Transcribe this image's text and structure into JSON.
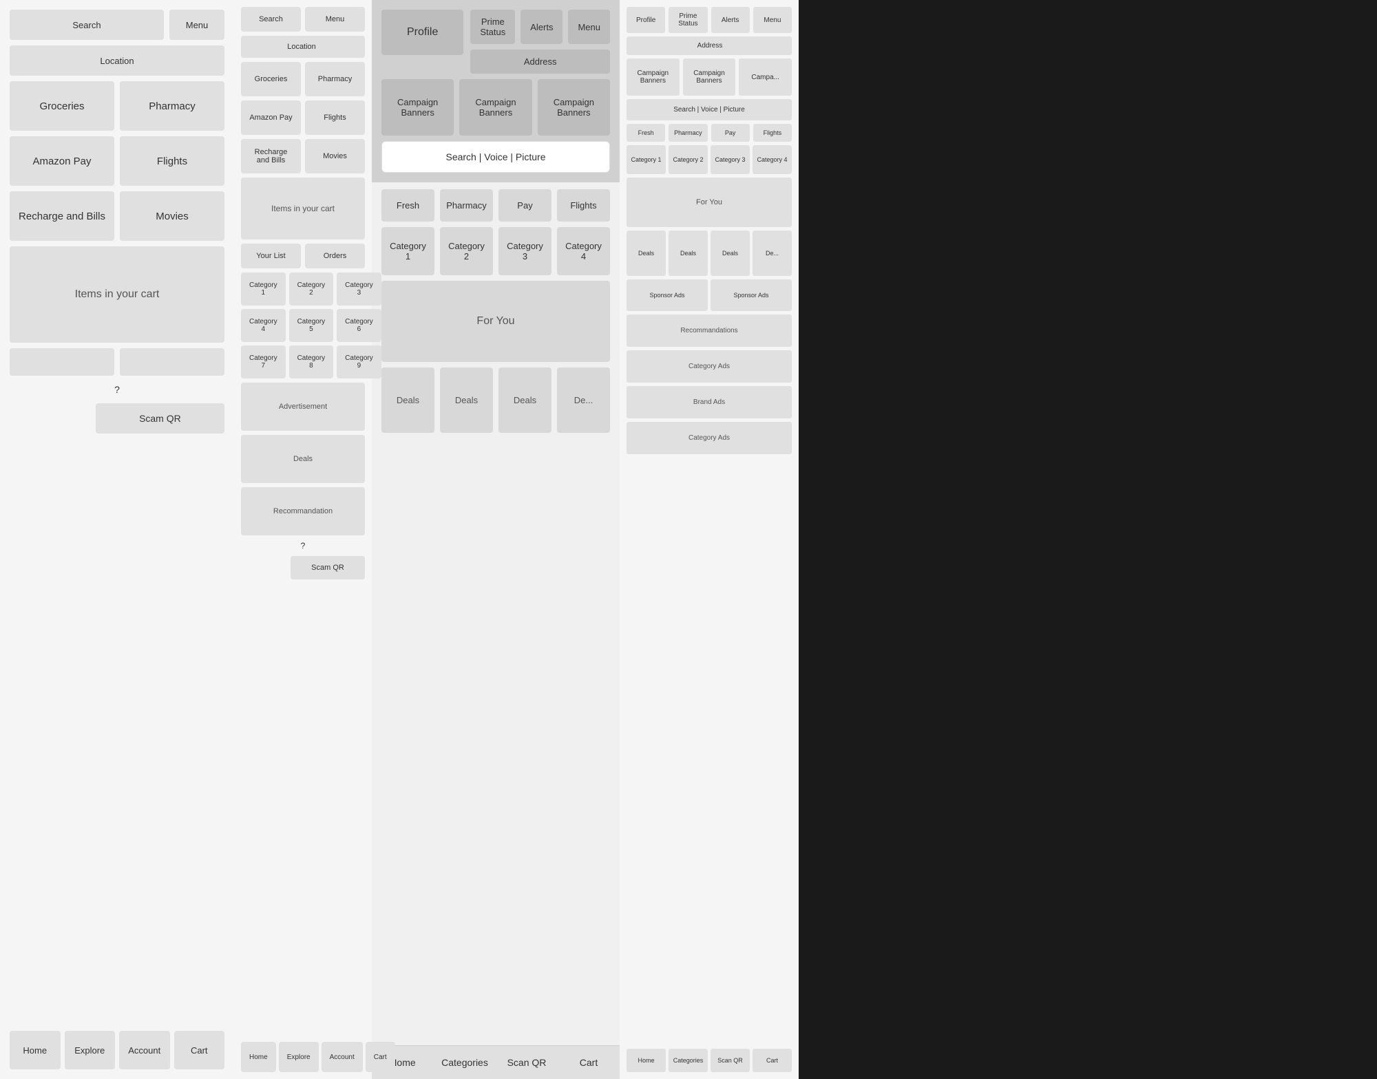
{
  "phone1": {
    "search": "Search",
    "menu": "Menu",
    "location": "Location",
    "groceries": "Groceries",
    "pharmacy": "Pharmacy",
    "amazon_pay": "Amazon Pay",
    "flights": "Flights",
    "recharge": "Recharge and Bills",
    "movies": "Movies",
    "cart_label": "Items in your cart",
    "question": "?",
    "scam_qr": "Scam QR",
    "nav": {
      "home": "Home",
      "explore": "Explore",
      "account": "Account",
      "cart": "Cart"
    }
  },
  "phone2": {
    "search": "Search",
    "menu": "Menu",
    "location": "Location",
    "groceries": "Groceries",
    "pharmacy": "Pharmacy",
    "amazon_pay": "Amazon Pay",
    "flights": "Flights",
    "recharge": "Recharge and Bills",
    "movies": "Movies",
    "your_list": "Your List",
    "orders": "Orders",
    "cart_label": "Items in your cart",
    "categories": [
      "Category 1",
      "Category 2",
      "Category 3",
      "Category 4",
      "Category 5",
      "Category 6",
      "Category 7",
      "Category 8",
      "Category 9"
    ],
    "advertisement": "Advertisement",
    "deals": "Deals",
    "recommandation": "Recommandation",
    "question": "?",
    "scam_qr": "Scam QR",
    "nav": {
      "home": "Home",
      "explore": "Explore",
      "account": "Account",
      "cart": "Cart"
    }
  },
  "phone3": {
    "profile": "Profile",
    "prime_status": "Prime Status",
    "alerts": "Alerts",
    "menu": "Menu",
    "address": "Address",
    "campaign_banners": [
      "Campaign Banners",
      "Campaign Banners",
      "Campaign Banners"
    ],
    "search_bar": "Search | Voice | Picture",
    "services": [
      "Fresh",
      "Pharmacy",
      "Pay",
      "Flights"
    ],
    "categories": [
      "Category 1",
      "Category 2",
      "Category 3",
      "Category 4"
    ],
    "for_you": "For You",
    "deals": [
      "Deals",
      "Deals",
      "Deals",
      "De..."
    ],
    "nav": {
      "home": "Home",
      "categories": "Categories",
      "scan_qr": "Scan QR",
      "cart": "Cart"
    }
  },
  "phone4": {
    "profile": "Profile",
    "prime_status": "Prime Status",
    "alerts": "Alerts",
    "menu": "Menu",
    "address": "Address",
    "campaign_banners": [
      "Campaign Banners",
      "Campaign Banners",
      "Campa..."
    ],
    "search_bar": "Search | Voice | Picture",
    "services": [
      "Fresh",
      "Pharmacy",
      "Pay",
      "Flights"
    ],
    "categories": [
      "Category 1",
      "Category 2",
      "Category 3",
      "Category 4"
    ],
    "for_you": "For You",
    "deals": [
      "Deals",
      "Deals",
      "Deals",
      "De..."
    ],
    "sponsor_ads": [
      "Sponsor Ads",
      "Sponsor Ads"
    ],
    "recommandations": "Recommandations",
    "category_ads1": "Category Ads",
    "brand_ads": "Brand Ads",
    "category_ads2": "Category Ads",
    "nav": {
      "home": "Home",
      "categories": "Categories",
      "scan_qr": "Scan QR",
      "cart": "Cart"
    }
  }
}
